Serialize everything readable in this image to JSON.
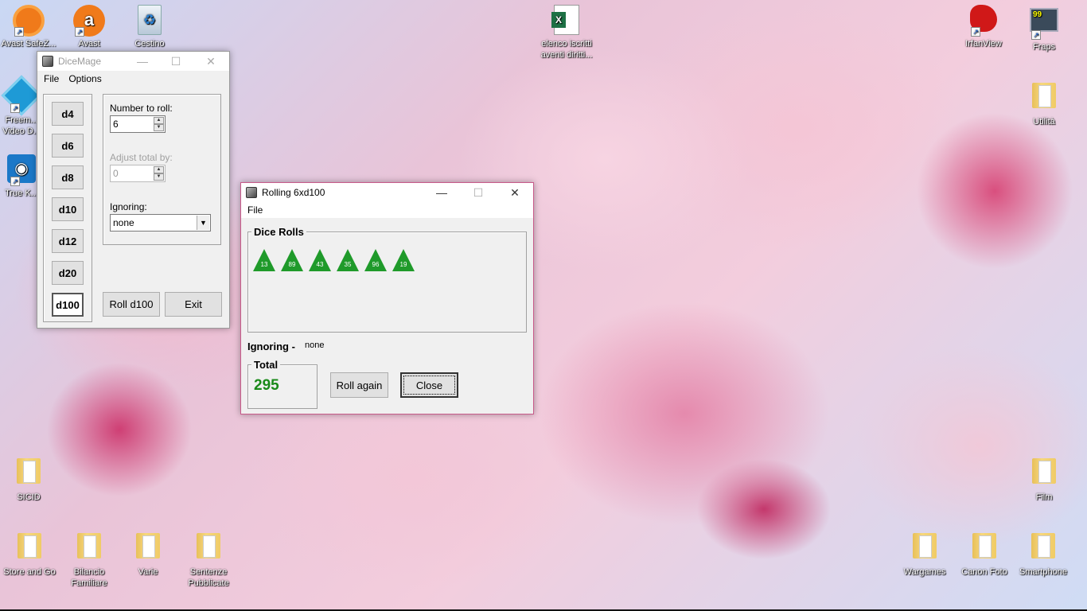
{
  "desktop": {
    "icons_left": [
      {
        "label": "Avast SafeZ...",
        "icon": "avast-safezone-icon"
      },
      {
        "label": "Avast",
        "icon": "avast-icon"
      },
      {
        "label": "Cestino",
        "icon": "recycle-bin-icon"
      },
      {
        "label": "Freem... Video D...",
        "icon": "freemake-icon"
      },
      {
        "label": "True K...",
        "icon": "truekey-icon"
      },
      {
        "label": "SICID",
        "icon": "folder-icon"
      },
      {
        "label": "Store and Go",
        "icon": "folder-icon"
      },
      {
        "label": "Bilancio Familiare",
        "icon": "folder-icon"
      },
      {
        "label": "Varie",
        "icon": "folder-icon"
      },
      {
        "label": "Sentenze Pubblicate",
        "icon": "folder-icon"
      }
    ],
    "icons_right": [
      {
        "label": "elenco iscritti aventi diritti...",
        "icon": "excel-file-icon"
      },
      {
        "label": "IrfanView",
        "icon": "irfanview-icon"
      },
      {
        "label": "Fraps",
        "icon": "fraps-icon"
      },
      {
        "label": "Utilità",
        "icon": "folder-icon"
      },
      {
        "label": "Film",
        "icon": "folder-icon"
      },
      {
        "label": "Wargames",
        "icon": "folder-icon"
      },
      {
        "label": "Canon Foto",
        "icon": "folder-icon"
      },
      {
        "label": "Smartphone",
        "icon": "folder-icon"
      }
    ]
  },
  "dicemage": {
    "title": "DiceMage",
    "menu": [
      "File",
      "Options"
    ],
    "dice_buttons": [
      "d4",
      "d6",
      "d8",
      "d10",
      "d12",
      "d20",
      "d100"
    ],
    "selected_die": "d100",
    "number_to_roll_label": "Number to roll:",
    "number_to_roll_value": "6",
    "adjust_label": "Adjust total by:",
    "adjust_value": "0",
    "ignoring_label": "Ignoring:",
    "ignoring_value": "none",
    "roll_button": "Roll d100",
    "exit_button": "Exit"
  },
  "rolling": {
    "title": "Rolling 6xd100",
    "menu": [
      "File"
    ],
    "dice_rolls_label": "Dice Rolls",
    "rolls": [
      "13",
      "89",
      "43",
      "35",
      "96",
      "19"
    ],
    "die_color": "#1f9a2a",
    "ignoring_label": "Ignoring -",
    "ignoring_value": "none",
    "total_label": "Total",
    "total_value": "295",
    "total_color": "#1a8a1a",
    "roll_again_button": "Roll again",
    "close_button": "Close"
  }
}
